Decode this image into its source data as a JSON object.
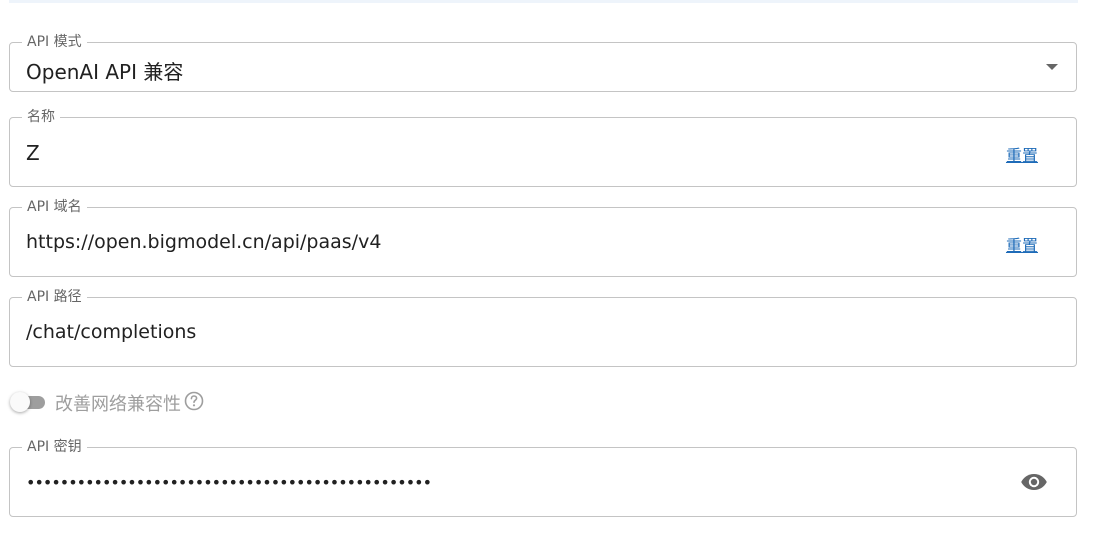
{
  "api_mode": {
    "label": "API 模式",
    "value": "OpenAI API 兼容"
  },
  "name": {
    "label": "名称",
    "value": "Z",
    "reset_label": "重置"
  },
  "api_domain": {
    "label": "API 域名",
    "value": "https://open.bigmodel.cn/api/paas/v4",
    "reset_label": "重置"
  },
  "api_path": {
    "label": "API 路径",
    "value": "/chat/completions"
  },
  "network_compat": {
    "label": "改善网络兼容性",
    "enabled": false,
    "help_icon": "help-circle-icon"
  },
  "api_key": {
    "label": "API 密钥",
    "masked_value": "••••••••••••••••••••••••••••••••••••••••••••••••",
    "toggle_icon": "eye-icon"
  },
  "colors": {
    "border": "#c4c4c4",
    "link": "#1e6bb8",
    "muted": "#9e9e9e"
  }
}
